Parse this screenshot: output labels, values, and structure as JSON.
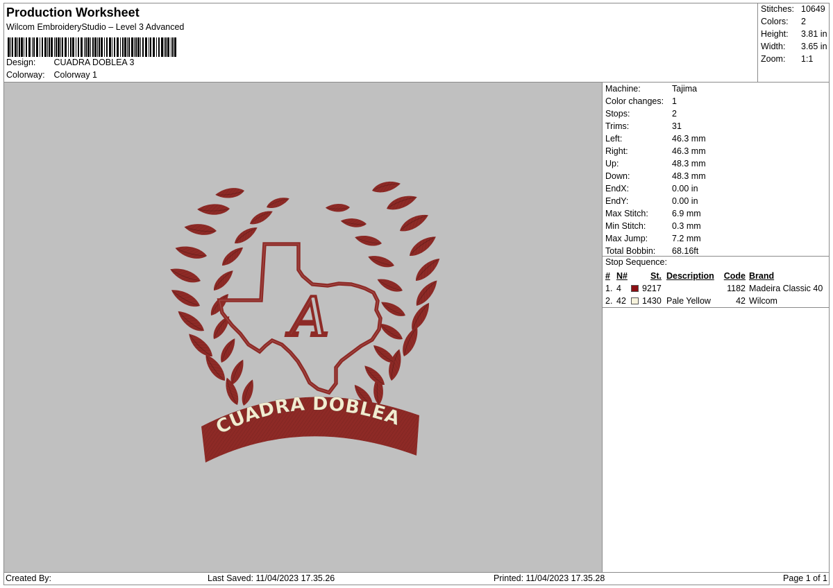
{
  "header": {
    "title": "Production Worksheet",
    "subtitle": "Wilcom EmbroideryStudio – Level 3 Advanced",
    "design_label": "Design:",
    "design_value": "CUADRA DOBLEA 3",
    "colorway_label": "Colorway:",
    "colorway_value": "Colorway 1"
  },
  "summary": {
    "stitches_label": "Stitches:",
    "stitches": "10649",
    "colors_label": "Colors:",
    "colors": "2",
    "height_label": "Height:",
    "height": "3.81 in",
    "width_label": "Width:",
    "width": "3.65 in",
    "zoom_label": "Zoom:",
    "zoom": "1:1"
  },
  "design_info": [
    {
      "label": "Machine:",
      "value": "Tajima"
    },
    {
      "label": "Color changes:",
      "value": "1"
    },
    {
      "label": "Stops:",
      "value": "2"
    },
    {
      "label": "Trims:",
      "value": "31"
    },
    {
      "label": "Left:",
      "value": "46.3 mm"
    },
    {
      "label": "Right:",
      "value": "46.3 mm"
    },
    {
      "label": "Up:",
      "value": "48.3 mm"
    },
    {
      "label": "Down:",
      "value": "48.3 mm"
    },
    {
      "label": "EndX:",
      "value": "0.00 in"
    },
    {
      "label": "EndY:",
      "value": "0.00 in"
    },
    {
      "label": "Max Stitch:",
      "value": "6.9 mm"
    },
    {
      "label": "Min Stitch:",
      "value": "0.3 mm"
    },
    {
      "label": "Max Jump:",
      "value": "7.2 mm"
    },
    {
      "label": "Total Bobbin:",
      "value": "68.16ft"
    }
  ],
  "stop_sequence": {
    "title": "Stop Sequence:",
    "headers": {
      "num": "#",
      "n": "N#",
      "st": "St.",
      "description": "Description",
      "code": "Code",
      "brand": "Brand"
    },
    "rows": [
      {
        "num": "1.",
        "n": "4",
        "swatch": "#8b0f14",
        "st": "9217",
        "description": "",
        "code": "1182",
        "brand": "Madeira Classic 40"
      },
      {
        "num": "2.",
        "n": "42",
        "swatch": "#f7f3dc",
        "st": "1430",
        "description": "Pale Yellow",
        "code": "42",
        "brand": "Wilcom"
      }
    ]
  },
  "design": {
    "banner_text": "CUADRA DOBLEA",
    "monogram": "A",
    "thread_main": "#8e2a26",
    "thread_text": "#f2ecd0"
  },
  "footer": {
    "created_by": "Created By:",
    "last_saved": "Last Saved: 11/04/2023 17.35.26",
    "printed": "Printed: 11/04/2023 17.35.28",
    "page": "Page 1 of 1"
  }
}
